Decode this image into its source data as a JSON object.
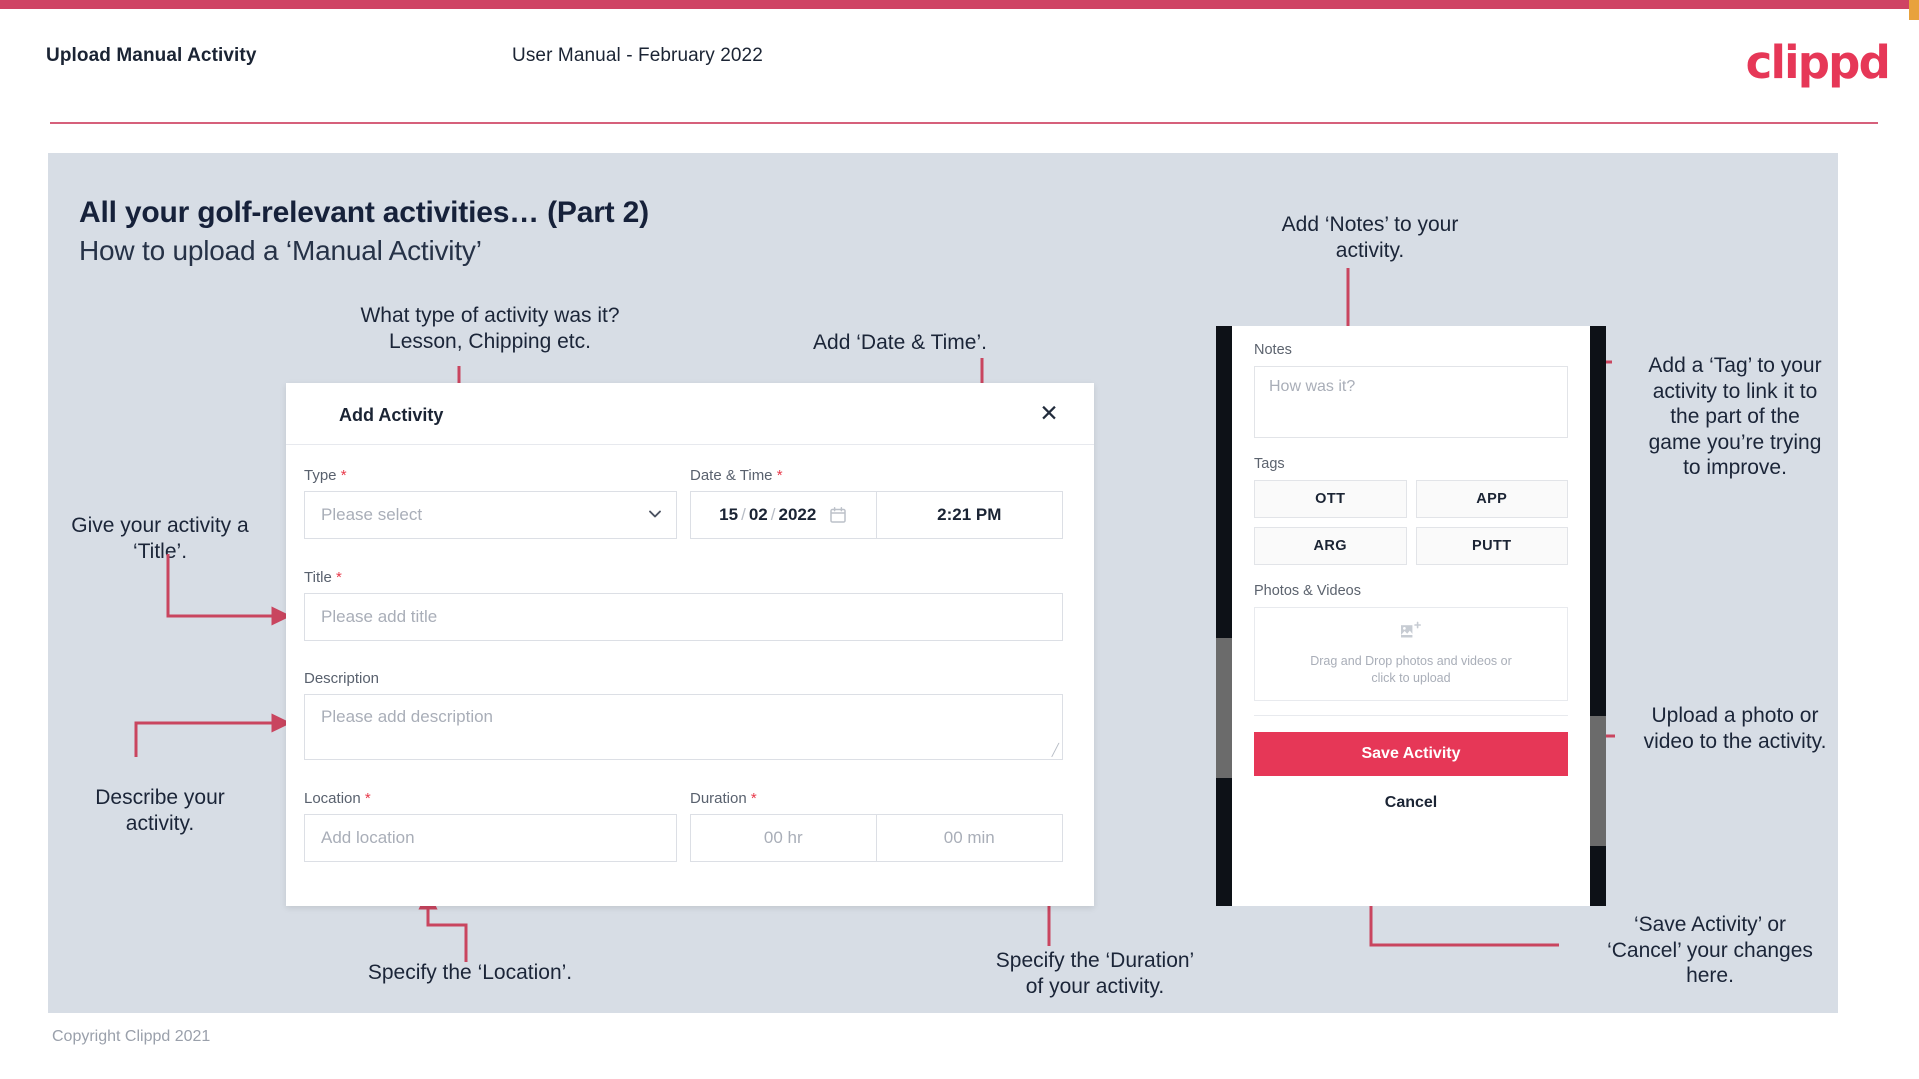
{
  "header": {
    "title": "Upload Manual Activity",
    "subtitle": "User Manual - February 2022",
    "logo": "clippd"
  },
  "slide": {
    "title": "All your golf-relevant activities… (Part 2)",
    "subtitle": "How to upload a ‘Manual Activity’"
  },
  "dialog": {
    "title": "Add Activity",
    "close_icon": "close-icon",
    "fields": {
      "type": {
        "label": "Type",
        "required": "*",
        "placeholder": "Please select",
        "chevron_icon": "chevron-down-icon"
      },
      "datetime": {
        "label": "Date & Time",
        "required": "*",
        "day": "15",
        "month": "02",
        "year": "2022",
        "sep": "/",
        "calendar_icon": "calendar-icon",
        "time": "2:21 PM"
      },
      "title": {
        "label": "Title",
        "required": "*",
        "placeholder": "Please add title"
      },
      "description": {
        "label": "Description",
        "required": "",
        "placeholder": "Please add description"
      },
      "location": {
        "label": "Location",
        "required": "*",
        "placeholder": "Add location"
      },
      "duration": {
        "label": "Duration",
        "required": "*",
        "hours": "00 hr",
        "minutes": "00 min"
      }
    }
  },
  "phone": {
    "notes": {
      "label": "Notes",
      "placeholder": "How was it?"
    },
    "tags": {
      "label": "Tags",
      "items": [
        "OTT",
        "APP",
        "ARG",
        "PUTT"
      ]
    },
    "photos": {
      "label": "Photos & Videos",
      "icon": "add-image-icon",
      "dropzone_line1": "Drag and Drop photos and videos or",
      "dropzone_line2": "click to upload"
    },
    "save_label": "Save Activity",
    "cancel_label": "Cancel"
  },
  "annotations": {
    "type": "What type of activity was it?\nLesson, Chipping etc.",
    "datetime": "Add ‘Date & Time’.",
    "title": "Give your activity a\n‘Title’.",
    "description": "Describe your\nactivity.",
    "location": "Specify the ‘Location’.",
    "duration": "Specify the ‘Duration’\nof your activity.",
    "notes": "Add ‘Notes’ to your\nactivity.",
    "tags": "Add a ‘Tag’ to your\nactivity to link it to\nthe part of the\ngame you’re trying\nto improve.",
    "photos": "Upload a photo or\nvideo to the activity.",
    "save": "‘Save Activity’ or\n‘Cancel’ your changes\nhere."
  },
  "footer": {
    "copyright": "Copyright Clippd 2021"
  },
  "colors": {
    "brand": "#e63757",
    "accent_bar": "#cf4464",
    "panel_bg": "#d7dde5",
    "text_dark": "#1b2434",
    "arrow": "#c9455f"
  }
}
